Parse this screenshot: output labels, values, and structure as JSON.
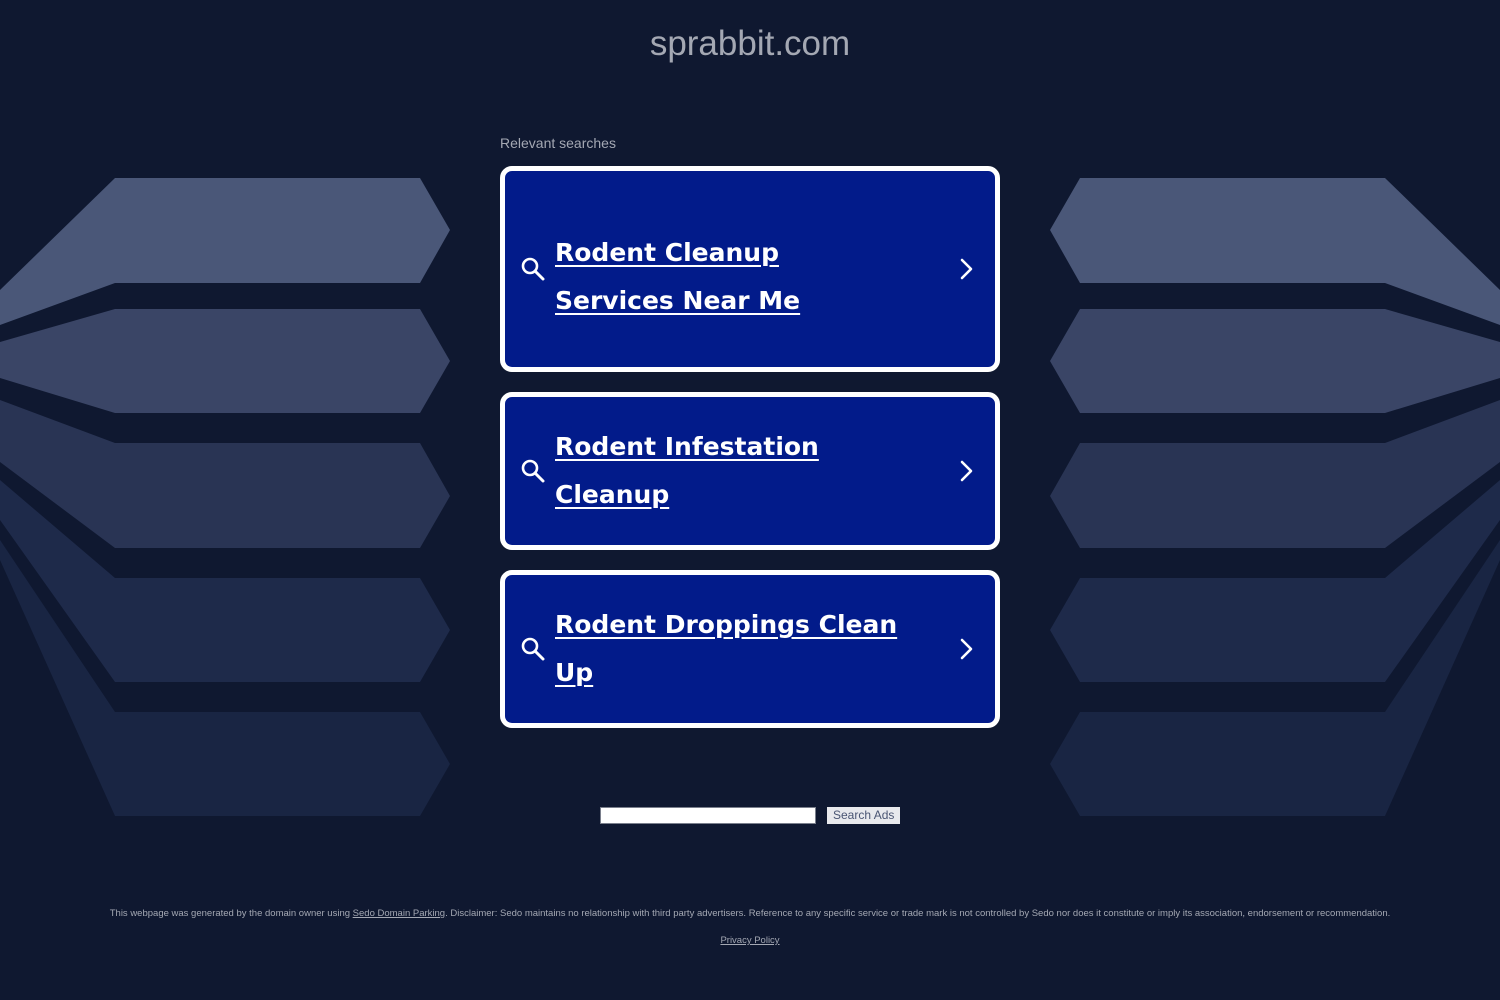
{
  "site": {
    "domain": "sprabbit.com"
  },
  "relevant": {
    "label": "Relevant searches",
    "items": [
      {
        "label": "Rodent Cleanup Services Near Me"
      },
      {
        "label": "Rodent Infestation Cleanup"
      },
      {
        "label": "Rodent Droppings Clean Up"
      }
    ]
  },
  "search": {
    "input_value": "",
    "button_label": "Search Ads"
  },
  "footer": {
    "disclaimer_prefix": "This webpage was generated by the domain owner using ",
    "sedo_link": "Sedo Domain Parking",
    "disclaimer_suffix": ". Disclaimer: Sedo maintains no relationship with third party advertisers. Reference to any specific service or trade mark is not controlled by Sedo nor does it constitute or imply its association, endorsement or recommendation.",
    "privacy_link": "Privacy Policy"
  },
  "icons": {
    "search": "search-icon",
    "chevron": "chevron-right-icon"
  },
  "colors": {
    "background": "#0f1830",
    "card_fill": "#021b8a",
    "card_border": "#ffffff",
    "muted_text": "#a4a8b3"
  }
}
